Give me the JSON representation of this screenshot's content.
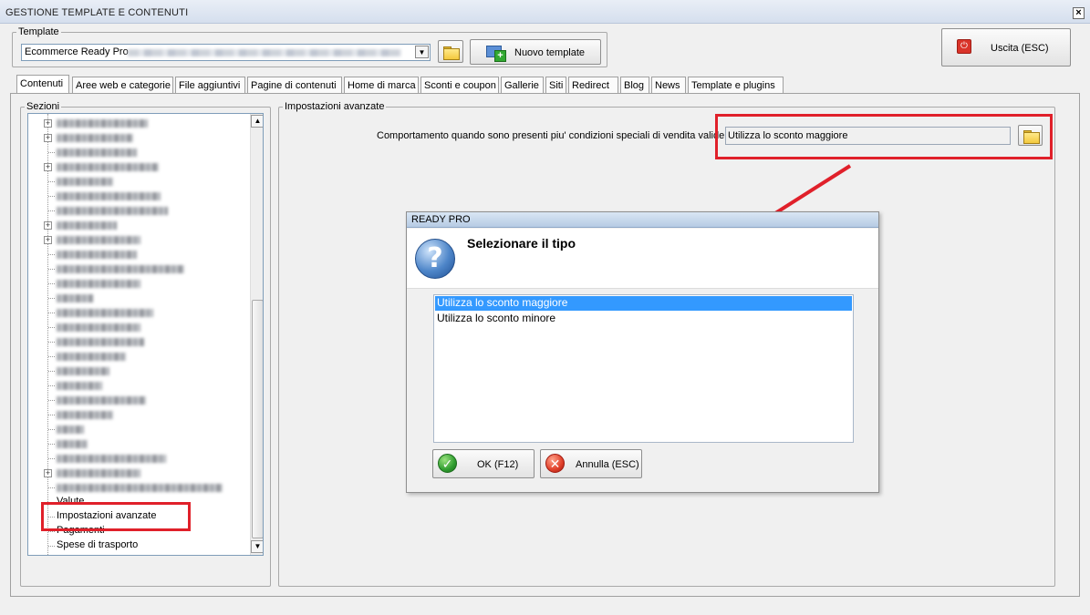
{
  "window": {
    "title": "GESTIONE TEMPLATE E CONTENUTI",
    "close_glyph": "×"
  },
  "template_group": {
    "legend": "Template",
    "combo_value": "Ecommerce Ready Pro",
    "new_template_label": "Nuovo template"
  },
  "exit_button": {
    "label": "Uscita (ESC)"
  },
  "tabs": [
    {
      "label": "Contenuti"
    },
    {
      "label": "Aree web e categorie"
    },
    {
      "label": "File aggiuntivi"
    },
    {
      "label": "Pagine di contenuti"
    },
    {
      "label": "Home di marca"
    },
    {
      "label": "Sconti e coupon"
    },
    {
      "label": "Gallerie"
    },
    {
      "label": "Siti"
    },
    {
      "label": "Redirect"
    },
    {
      "label": "Blog"
    },
    {
      "label": "News"
    },
    {
      "label": "Template e plugins"
    }
  ],
  "sections": {
    "legend": "Sezioni",
    "visible_items": [
      {
        "label": "Valute"
      },
      {
        "label": "Impostazioni avanzate"
      },
      {
        "label": "Pagamenti"
      },
      {
        "label": "Spese di trasporto"
      }
    ]
  },
  "advanced": {
    "legend": "Impostazioni avanzate",
    "behaviour_label": "Comportamento quando sono presenti piu' condizioni speciali di vendita valide :",
    "behaviour_value": "Utilizza lo sconto maggiore"
  },
  "dialog": {
    "title": "READY PRO",
    "heading": "Selezionare il tipo",
    "options": [
      {
        "label": "Utilizza lo sconto maggiore",
        "selected": true
      },
      {
        "label": "Utilizza lo sconto minore",
        "selected": false
      }
    ],
    "ok_label": "OK (F12)",
    "cancel_label": "Annulla (ESC)"
  },
  "colors": {
    "highlight_box": "#e0202a",
    "selection": "#3399ff"
  }
}
